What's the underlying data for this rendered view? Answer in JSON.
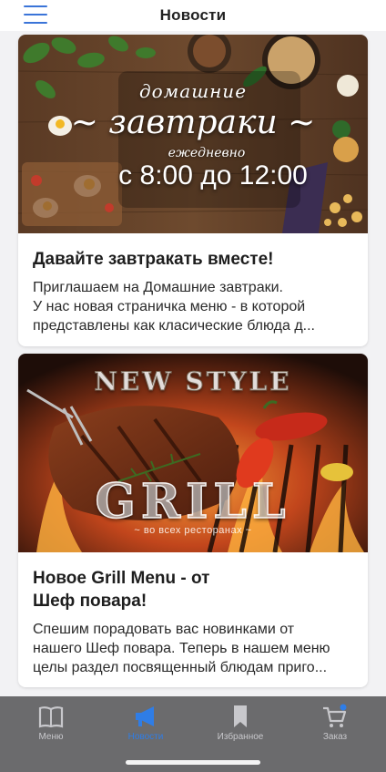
{
  "header": {
    "title": "Новости",
    "menu_icon": "hamburger-menu-icon"
  },
  "posts": [
    {
      "image": {
        "line1": "домашние",
        "line2": "~ завтраки ~",
        "line3": "ежедневно",
        "line4": "с 8:00 до 12:00"
      },
      "title": "Давайте завтракать вместе!",
      "description": [
        "Приглашаем на Домашние завтраки.",
        "У нас новая страничка меню - в которой",
        "представлены как класические блюда д..."
      ]
    },
    {
      "image": {
        "top": "NEW STYLE",
        "main": "GRILL",
        "sub": "~ во всех ресторанах ~"
      },
      "title_line1": "Новое  Grill Menu - от",
      "title_line2": "Шеф повара!",
      "description": [
        "Спешим порадовать вас новинками от",
        "нашего Шеф повара. Теперь в нашем меню",
        "целы раздел посвященный блюдам приго..."
      ]
    }
  ],
  "tabs": [
    {
      "label": "Меню",
      "icon": "book-icon",
      "active": false
    },
    {
      "label": "Новости",
      "icon": "megaphone-icon",
      "active": true
    },
    {
      "label": "Избранное",
      "icon": "bookmark-icon",
      "active": false
    },
    {
      "label": "Заказ",
      "icon": "cart-icon",
      "active": false
    }
  ],
  "colors": {
    "accent": "#2f7de6",
    "tabbar_bg": "#6b6b6d",
    "inactive_tab": "#c8c8cc"
  }
}
